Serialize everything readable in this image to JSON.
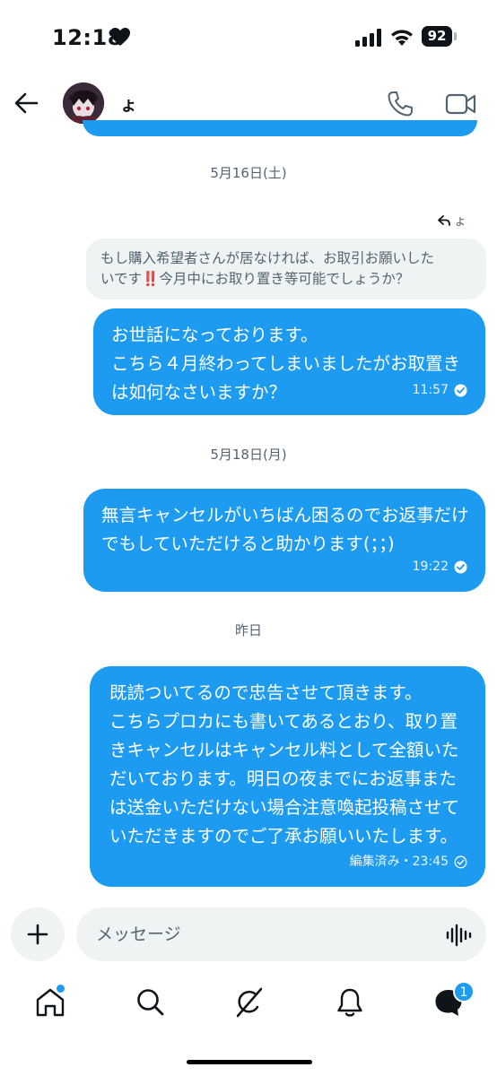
{
  "status_bar": {
    "time": "12:18",
    "battery": "92",
    "icons": [
      "heart-icon",
      "signal-icon",
      "wifi-icon",
      "battery-icon"
    ]
  },
  "header": {
    "contact_name": "ょ",
    "icons": [
      "back-arrow-icon",
      "avatar",
      "phone-icon",
      "video-icon"
    ]
  },
  "conversation": {
    "date_1": "5月16日(土)",
    "reply_to": "ょ",
    "quoted_line_1_pre": "もし購入希望者さんが居なければ、お取引お願いした",
    "quoted_line_2_pre": "いです",
    "quoted_bang": "‼️",
    "quoted_line_2_post": "今月中にお取り置き等可能でしょうか？",
    "message_1": {
      "text": "お世話になっております。\nこちら４月終わってしまいましたがお取置きは如何なさいますか？",
      "time": "11:57"
    },
    "date_2": "5月18日(月)",
    "message_2": {
      "text": "無言キャンセルがいちばん困るのでお返事だけでもしていただけると助かります(；；)",
      "time": "19:22"
    },
    "date_3": "昨日",
    "message_3": {
      "text": "既読ついてるので忠告させて頂きます。\nこちらプロカにも書いてあるとおり、取り置きキャンセルはキャンセル料として全額いただいております。明日の夜までにお返事または送金いただけない場合注意喚起投稿させていただきますのでご了承お願いいたします。",
      "edited_label": "編集済み・23:45"
    }
  },
  "composer": {
    "placeholder": "メッセージ",
    "icons": [
      "plus-icon",
      "voice-icon"
    ]
  },
  "bottom_nav": {
    "items": [
      "home-icon",
      "search-icon",
      "grok-icon",
      "notifications-icon",
      "messages-icon"
    ],
    "messages_badge": "1"
  },
  "colors": {
    "accent": "#1d9bf0",
    "quoted_bg": "#eff3f4",
    "muted_text": "#536471"
  }
}
